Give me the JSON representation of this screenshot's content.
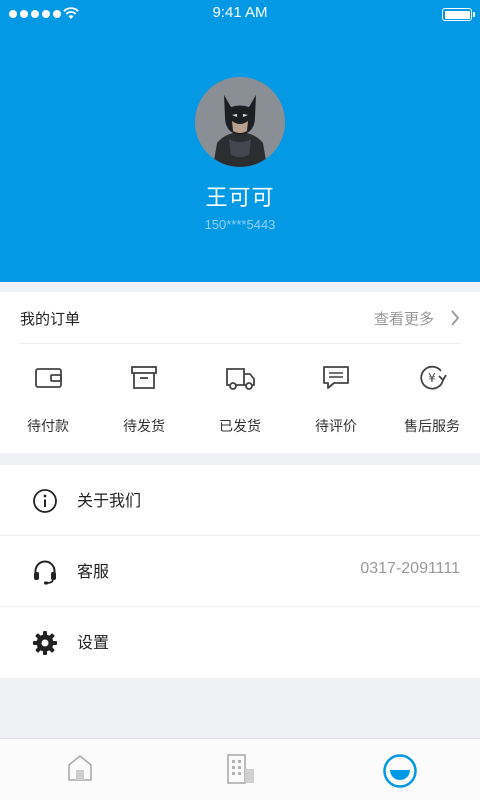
{
  "status_bar": {
    "time": "9:41 AM"
  },
  "profile": {
    "name": "王可可",
    "phone": "150****5443",
    "avatar_icon": "batman-avatar"
  },
  "orders": {
    "title": "我的订单",
    "more_label": "查看更多",
    "items": [
      {
        "label": "待付款",
        "icon": "wallet-icon"
      },
      {
        "label": "待发货",
        "icon": "archive-box-icon"
      },
      {
        "label": "已发货",
        "icon": "truck-icon"
      },
      {
        "label": "待评价",
        "icon": "comment-icon"
      },
      {
        "label": "售后服务",
        "icon": "yen-refresh-icon"
      }
    ]
  },
  "menu": {
    "items": [
      {
        "label": "关于我们",
        "icon": "info-icon",
        "value": ""
      },
      {
        "label": "客服",
        "icon": "headset-icon",
        "value": "0317-2091111"
      },
      {
        "label": "设置",
        "icon": "gear-icon",
        "value": ""
      }
    ]
  },
  "tabbar": {
    "tabs": [
      {
        "icon": "home-icon",
        "active": false
      },
      {
        "icon": "building-icon",
        "active": false
      },
      {
        "icon": "profile-smile-icon",
        "active": true
      }
    ],
    "active_color": "#0399e5",
    "inactive_color": "#b5b5b5"
  },
  "colors": {
    "header_bg": "#0399e5",
    "page_bg": "#eff1f4"
  }
}
